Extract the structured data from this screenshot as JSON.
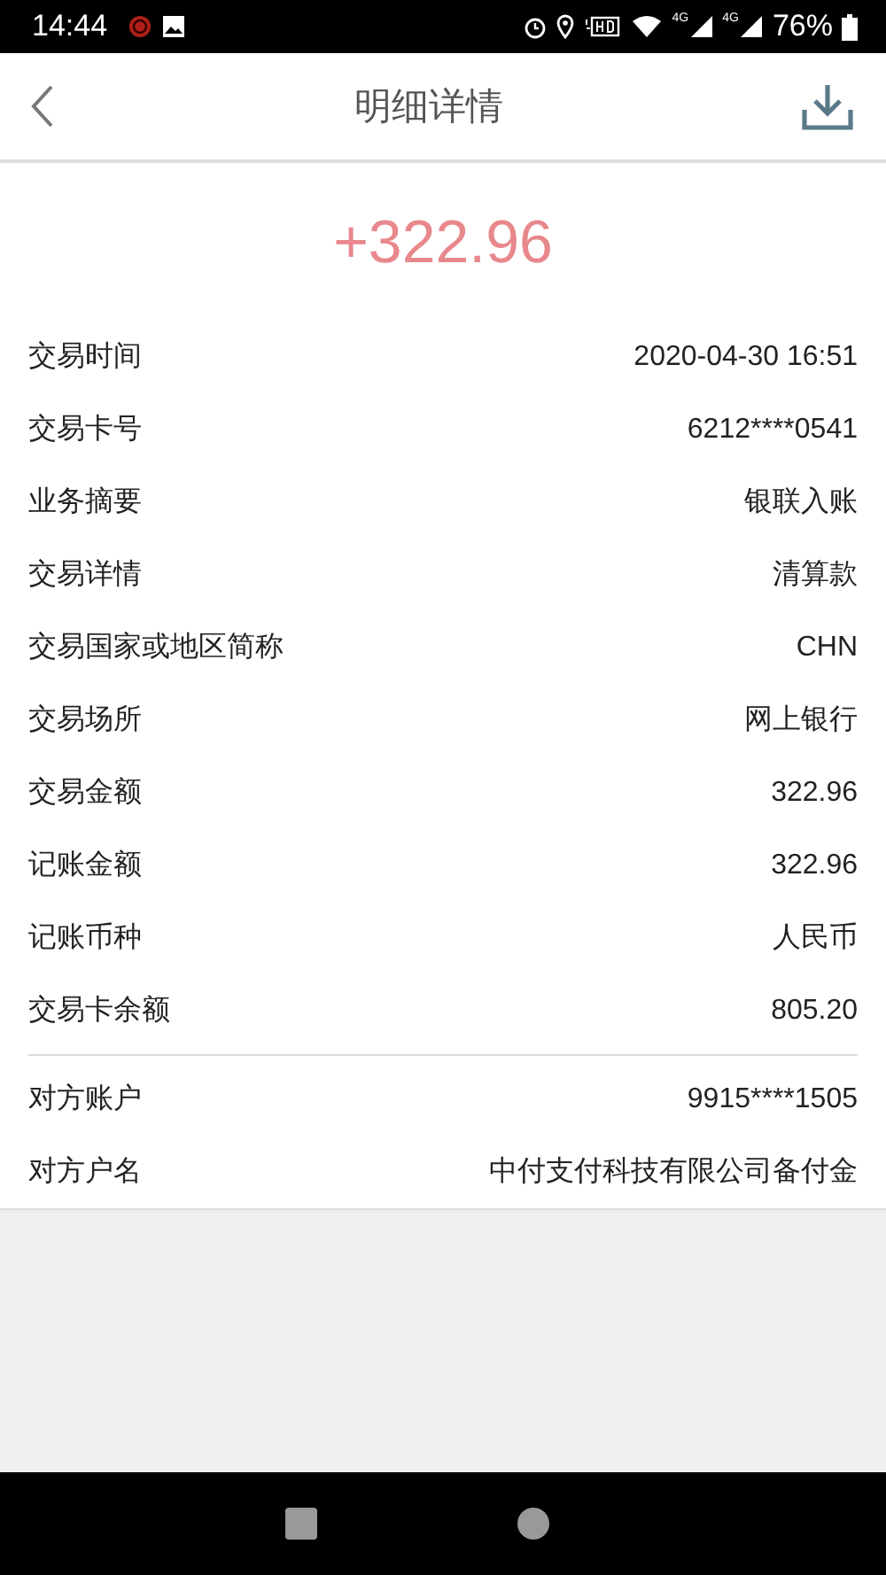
{
  "status_bar": {
    "time": "14:44",
    "battery": "76%",
    "network": [
      "4G",
      "4G"
    ]
  },
  "header": {
    "title": "明细详情"
  },
  "amount": "+322.96",
  "groups": [
    [
      {
        "label": "交易时间",
        "value": "2020-04-30 16:51"
      },
      {
        "label": "交易卡号",
        "value": "6212****0541"
      },
      {
        "label": "业务摘要",
        "value": "银联入账"
      },
      {
        "label": "交易详情",
        "value": "清算款"
      },
      {
        "label": "交易国家或地区简称",
        "value": "CHN"
      },
      {
        "label": "交易场所",
        "value": "网上银行"
      },
      {
        "label": "交易金额",
        "value": "322.96"
      },
      {
        "label": "记账金额",
        "value": "322.96"
      },
      {
        "label": "记账币种",
        "value": "人民币"
      },
      {
        "label": "交易卡余额",
        "value": "805.20"
      }
    ],
    [
      {
        "label": "对方账户",
        "value": "9915****1505"
      },
      {
        "label": "对方户名",
        "value": "中付支付科技有限公司备付金"
      }
    ]
  ]
}
